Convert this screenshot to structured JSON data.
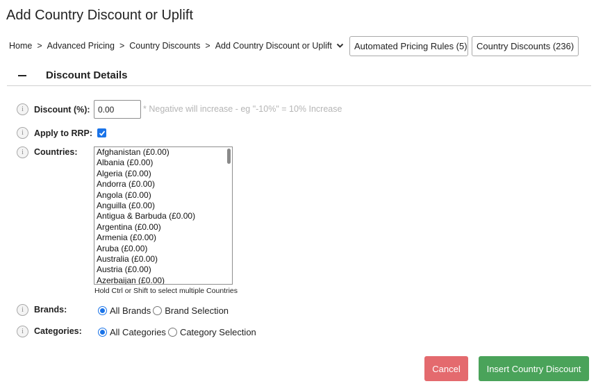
{
  "page": {
    "title": "Add Country Discount or Uplift"
  },
  "breadcrumb": {
    "items": [
      "Home",
      "Advanced Pricing",
      "Country Discounts",
      "Add Country Discount or Uplift"
    ],
    "separator": ">",
    "dropdown_icon": "chevron-down-icon"
  },
  "top_buttons": {
    "automated_rules": "Automated Pricing Rules (5)",
    "country_discounts": "Country Discounts (236)"
  },
  "section": {
    "title": "Discount Details",
    "collapse_icon": "minus-icon"
  },
  "form": {
    "info_icon": "info-icon",
    "discount": {
      "label": "Discount (%):",
      "value": "0.00",
      "hint": "* Negative will increase - eg \"-10%\" = 10% Increase"
    },
    "apply_rrp": {
      "label": "Apply to RRP:",
      "checked": true
    },
    "countries": {
      "label": "Countries:",
      "options": [
        "Afghanistan (£0.00)",
        "Albania (£0.00)",
        "Algeria (£0.00)",
        "Andorra (£0.00)",
        "Angola (£0.00)",
        "Anguilla (£0.00)",
        "Antigua & Barbuda (£0.00)",
        "Argentina (£0.00)",
        "Armenia (£0.00)",
        "Aruba (£0.00)",
        "Australia (£0.00)",
        "Austria (£0.00)",
        "Azerbaijan (£0.00)"
      ],
      "help": "Hold Ctrl or Shift to select multiple Countries"
    },
    "brands": {
      "label": "Brands:",
      "options": [
        {
          "label": "All Brands",
          "checked": true
        },
        {
          "label": "Brand Selection",
          "checked": false
        }
      ]
    },
    "categories": {
      "label": "Categories:",
      "options": [
        {
          "label": "All Categories",
          "checked": true
        },
        {
          "label": "Category Selection",
          "checked": false
        }
      ]
    }
  },
  "actions": {
    "cancel": "Cancel",
    "insert": "Insert Country Discount"
  },
  "colors": {
    "accent": "#1a73e8",
    "cancel_bg": "#e46a6e",
    "insert_bg": "#4aa35a",
    "hint_text": "#b5b5b5"
  }
}
